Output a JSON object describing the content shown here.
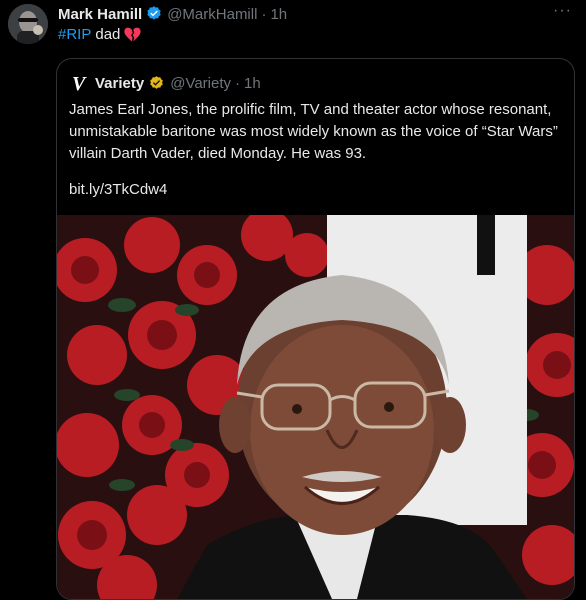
{
  "tweet": {
    "author_name": "Mark Hamill",
    "handle": "@MarkHamill",
    "separator": "·",
    "time": "1h",
    "hashtag": "#RIP",
    "word": "dad",
    "more_label": "···"
  },
  "quote": {
    "author_name": "Variety",
    "handle": "@Variety",
    "separator": "·",
    "time": "1h",
    "logo_letter": "V",
    "text": "James Earl Jones, the prolific film, TV and theater actor whose resonant, unmistakable baritone was most widely known as the voice of “Star Wars” villain Darth Vader, died Monday. He was 93.",
    "link": "bit.ly/3TkCdw4"
  },
  "colors": {
    "background": "#000000",
    "link_blue": "#1d9bf0",
    "muted": "#71767b",
    "verified_blue": "#1d9bf0",
    "verified_gold": "#e2b719",
    "broken_heart": "#f4375b"
  },
  "icons": {
    "verified": "verified-badge-icon",
    "gold_verified": "gold-verified-badge-icon",
    "broken_heart": "broken-heart-icon",
    "more": "more-icon"
  }
}
